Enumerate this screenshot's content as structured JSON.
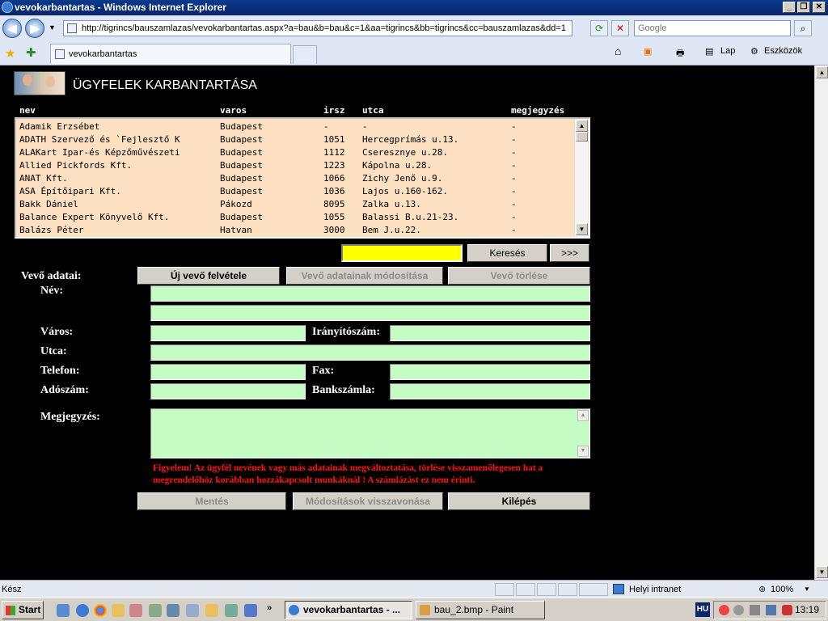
{
  "window": {
    "title": "vevokarbantartas - Windows Internet Explorer",
    "minimize": "_",
    "maximize": "❐",
    "close": "✕"
  },
  "address": {
    "url": "http://tigrincs/bauszamlazas/vevokarbantartas.aspx?a=bau&b=bau&c=1&aa=tigrincs&bb=tigrincs&cc=bauszamlazas&dd=1",
    "search_placeholder": "Google"
  },
  "tabs": {
    "active_label": "vevokarbantartas"
  },
  "toolbar": {
    "page_label": "Lap",
    "tools_label": "Eszközök"
  },
  "page": {
    "heading": "ÜGYFELEK KARBANTARTÁSA",
    "columns": {
      "nev": "nev",
      "varos": "varos",
      "irsz": "irsz",
      "utca": "utca",
      "megjegyzes": "megjegyzés"
    },
    "rows": [
      {
        "nev": "Adamik Erzsébet",
        "varos": "Budapest",
        "irsz": "-",
        "utca": "-",
        "megj": "-"
      },
      {
        "nev": "ADATH Szervező és `Fejlesztő K",
        "varos": "Budapest",
        "irsz": "1051",
        "utca": "Hercegprímás u.13.",
        "megj": "-"
      },
      {
        "nev": "ALAKart Ipar-és Képzőművészeti",
        "varos": "Budapest",
        "irsz": "1112",
        "utca": "Cseresznye u.28.",
        "megj": "-"
      },
      {
        "nev": "Allied Pickfords Kft.",
        "varos": "Budapest",
        "irsz": "1223",
        "utca": "Kápolna u.28.",
        "megj": "-"
      },
      {
        "nev": "ANAT Kft.",
        "varos": "Budapest",
        "irsz": "1066",
        "utca": "Zichy Jenő u.9.",
        "megj": "-"
      },
      {
        "nev": "ASA Építőipari Kft.",
        "varos": "Budapest",
        "irsz": "1036",
        "utca": "Lajos u.160-162.",
        "megj": "-"
      },
      {
        "nev": "Bakk Dániel",
        "varos": "Pákozd",
        "irsz": "8095",
        "utca": "Zalka u.13.",
        "megj": "-"
      },
      {
        "nev": "Balance Expert Könyvelő Kft.",
        "varos": "Budapest",
        "irsz": "1055",
        "utca": "Balassi B.u.21-23.",
        "megj": "-"
      },
      {
        "nev": "Balázs Péter",
        "varos": "Hatvan",
        "irsz": "3000",
        "utca": "Bem J.u.22.",
        "megj": "-"
      }
    ],
    "search_button": "Keresés",
    "next_button": ">>>",
    "section_label": "Vevő adatai:",
    "new_button": "Új vevő felvétele",
    "modify_button": "Vevő adatainak módosítása",
    "delete_button": "Vevő törlése",
    "labels": {
      "name": "Név:",
      "city": "Város:",
      "zip": "Irányítószám:",
      "street": "Utca:",
      "phone": "Telefon:",
      "fax": "Fax:",
      "tax": "Adószám:",
      "bank": "Bankszámla:",
      "note": "Megjegyzés:"
    },
    "warning": "Figyelem! Az ügyfél nevének vagy más adatainak megváltoztatása, törlése visszamenőlegesen hat a megrendelőhöz korábban hozzákapcsolt munkáknál ! A számlázást ez nem érinti.",
    "save_button": "Mentés",
    "undo_button": "Módosítások visszavonása",
    "exit_button": "Kilépés"
  },
  "status": {
    "left": "Kész",
    "zone": "Helyi intranet",
    "zoom": "100%"
  },
  "taskbar": {
    "start": "Start",
    "item1": "vevokarbantartas - ...",
    "item2": "bau_2.bmp - Paint",
    "lang": "HU",
    "clock": "13:19"
  },
  "colors": {
    "list_bg": "#fde0c2",
    "field_bg": "#c4fcc4",
    "search_bg": "#ffff00",
    "warning": "#ff1010"
  }
}
